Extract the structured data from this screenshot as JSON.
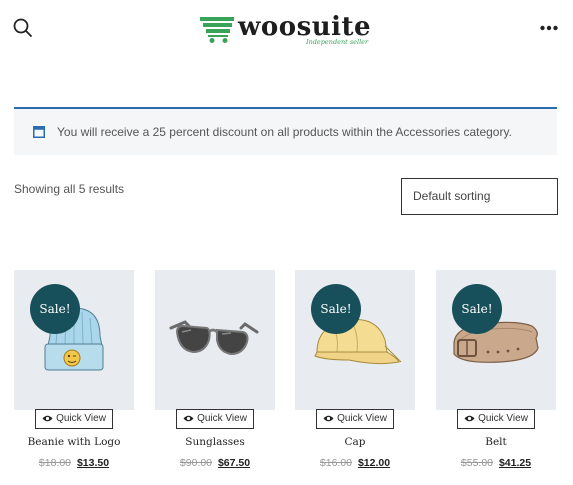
{
  "header": {
    "logo_text": "woosuite",
    "logo_tagline": "Independent seller",
    "search_icon": "search-icon",
    "menu_icon": "more-horizontal-icon"
  },
  "notice": {
    "icon": "calendar-icon",
    "text": "You will receive a 25 percent discount on all products within the Accessories category.",
    "accent_color": "#2b6cb0"
  },
  "shop": {
    "result_count": "Showing all 5 results",
    "sorting_selected": "Default sorting"
  },
  "colors": {
    "sale_badge": "#17505a",
    "image_background": "#e8ecf1",
    "logo_green": "#3aa35a"
  },
  "products": [
    {
      "title": "Beanie with Logo",
      "old_price": "$18.00",
      "new_price": "$13.50",
      "sale": "Sale!",
      "quick_view": "Quick View",
      "icon": "beanie-icon"
    },
    {
      "title": "Sunglasses",
      "old_price": "$90.00",
      "new_price": "$67.50",
      "sale": "",
      "quick_view": "Quick View",
      "icon": "sunglasses-icon"
    },
    {
      "title": "Cap",
      "old_price": "$16.00",
      "new_price": "$12.00",
      "sale": "Sale!",
      "quick_view": "Quick View",
      "icon": "cap-icon"
    },
    {
      "title": "Belt",
      "old_price": "$55.00",
      "new_price": "$41.25",
      "sale": "Sale!",
      "quick_view": "Quick View",
      "icon": "belt-icon"
    }
  ]
}
